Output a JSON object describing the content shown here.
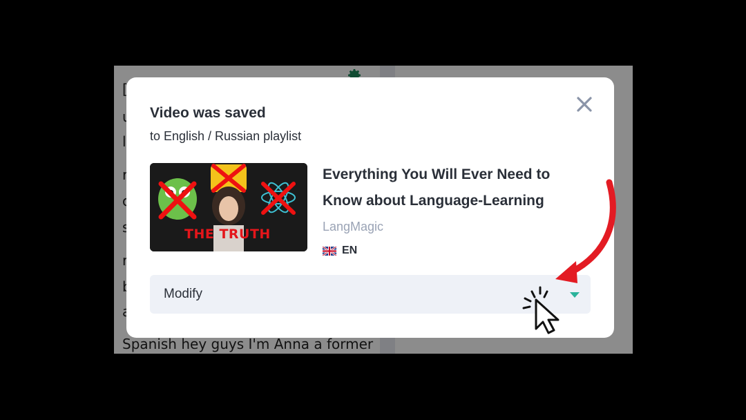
{
  "background": {
    "lines": [
      "[",
      "u",
      "l",
      "r",
      "c",
      "s",
      "r",
      "b",
      "a",
      "Spanish hey guys I'm Anna a former"
    ]
  },
  "modal": {
    "title": "Video was saved",
    "subtitle": "to English / Russian playlist",
    "video": {
      "title": "Everything You Will Ever Need to Know about Language-Learning",
      "channel": "LangMagic",
      "language_code": "EN",
      "thumbnail_text": "THE TRUTH"
    },
    "modify_label": "Modify"
  },
  "colors": {
    "accent": "#2bb39b",
    "annotation_arrow": "#e31b23"
  }
}
